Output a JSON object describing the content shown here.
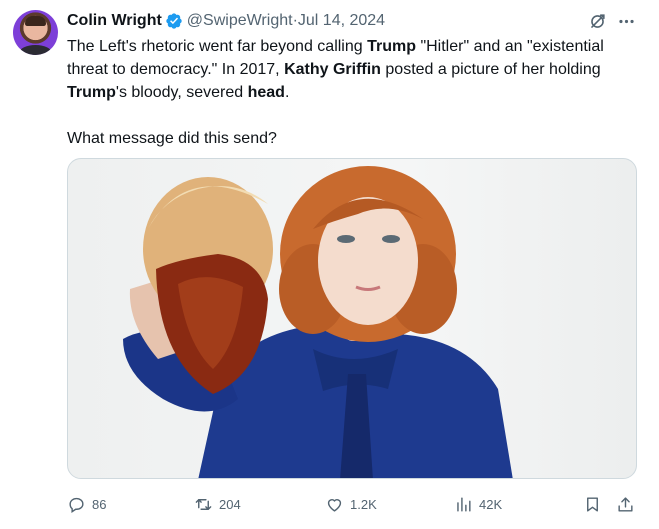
{
  "tweet": {
    "author_name": "Colin Wright",
    "handle": "@SwipeWright",
    "separator": " · ",
    "date": "Jul 14, 2024",
    "text_parts": [
      {
        "text": "The Left's rhetoric went far beyond calling ",
        "bold": false
      },
      {
        "text": "Trump",
        "bold": true
      },
      {
        "text": " \"Hitler\" and an \"existential threat to democracy.\" In 2017, ",
        "bold": false
      },
      {
        "text": "Kathy Griffin",
        "bold": true
      },
      {
        "text": " posted a picture of her holding ",
        "bold": false
      },
      {
        "text": "Trump",
        "bold": true
      },
      {
        "text": "'s bloody, severed ",
        "bold": false
      },
      {
        "text": "head",
        "bold": true
      },
      {
        "text": ".",
        "bold": false
      }
    ],
    "question": "What message did this send?"
  },
  "stats": {
    "replies": "86",
    "retweets": "204",
    "likes": "1.2K",
    "views": "42K"
  },
  "icons": {
    "verified": "verified-badge-icon",
    "grok": "grok-icon",
    "more": "more-icon",
    "reply": "reply-icon",
    "retweet": "retweet-icon",
    "like": "like-icon",
    "views": "views-icon",
    "bookmark": "bookmark-icon",
    "share": "share-icon"
  },
  "colors": {
    "text": "#0f1419",
    "secondary": "#536471",
    "verified_blue": "#1d9bf0",
    "border": "#cfd9de"
  }
}
